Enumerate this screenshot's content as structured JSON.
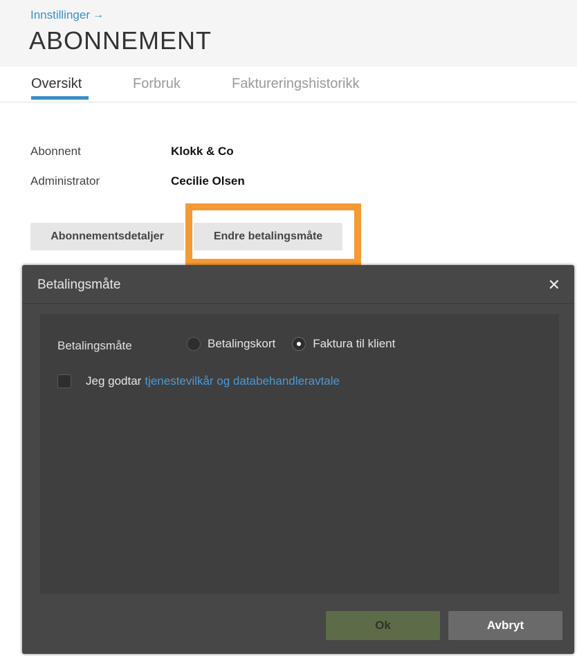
{
  "header": {
    "breadcrumb": "Innstillinger",
    "breadcrumb_arrow": "→",
    "title": "ABONNEMENT"
  },
  "tabs": [
    {
      "label": "Oversikt",
      "active": true
    },
    {
      "label": "Forbruk",
      "active": false
    },
    {
      "label": "Faktureringshistorikk",
      "active": false
    }
  ],
  "info": {
    "subscriber_label": "Abonnent",
    "subscriber_value": "Klokk & Co",
    "admin_label": "Administrator",
    "admin_value": "Cecilie Olsen"
  },
  "actions": {
    "details_label": "Abonnementsdetaljer",
    "change_payment_label": "Endre betalingsmåte"
  },
  "modal": {
    "title": "Betalingsmåte",
    "close_glyph": "✕",
    "payment_label": "Betalingsmåte",
    "options": [
      {
        "label": "Betalingskort",
        "selected": false
      },
      {
        "label": "Faktura til klient",
        "selected": true
      }
    ],
    "terms_prefix": "Jeg godtar",
    "terms_link": "tjenestevilkår og databehandleravtale",
    "terms_checked": false,
    "ok_label": "Ok",
    "cancel_label": "Avbryt"
  },
  "colors": {
    "accent": "#3a8fc9",
    "highlight": "#f59a33",
    "modal_bg": "#474747",
    "ok_bg": "#5d6b48"
  }
}
